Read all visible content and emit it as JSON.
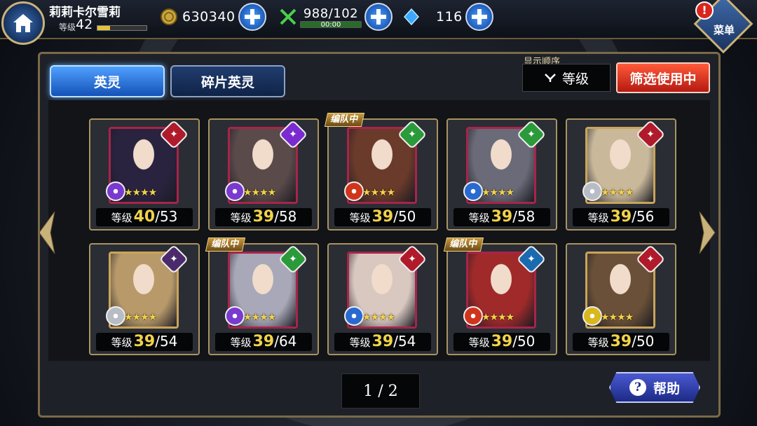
{
  "header": {
    "player_name": "莉莉卡尔雪莉",
    "level_label": "等级",
    "level_value": "42",
    "exp_fraction": 0.25,
    "gold": "630340",
    "stamina": "988/102",
    "stamina_timer": "00:00",
    "crystals": "116",
    "menu_label": "菜单",
    "alert_symbol": "!"
  },
  "tabs": [
    {
      "label": "英灵",
      "active": true
    },
    {
      "label": "碎片英灵",
      "active": false
    }
  ],
  "sort": {
    "caption": "显示顺序",
    "value": "等级"
  },
  "filter_label": "筛选使用中",
  "level_word": "等级",
  "team_tag": "编队中",
  "cards": [
    {
      "cur": "40",
      "max": "/53",
      "class_color": "#b01a2a",
      "class_icon": "sword-icon",
      "elem_color": "#7a3ad0",
      "portrait_color": "#2a2340",
      "in_team": false
    },
    {
      "cur": "39",
      "max": "/58",
      "class_color": "#7a2ad0",
      "class_icon": "witch-hat-icon",
      "elem_color": "#7a3ad0",
      "portrait_color": "#5a4a4a",
      "in_team": false
    },
    {
      "cur": "39",
      "max": "/50",
      "class_color": "#2a9a3a",
      "class_icon": "dagger-icon",
      "elem_color": "#d0351c",
      "portrait_color": "#6a3a2a",
      "in_team": true
    },
    {
      "cur": "39",
      "max": "/58",
      "class_color": "#2a9a3a",
      "class_icon": "potion-icon",
      "elem_color": "#2a6ad0",
      "portrait_color": "#6a6a78",
      "in_team": false
    },
    {
      "cur": "39",
      "max": "/56",
      "class_color": "#b01a2a",
      "class_icon": "sword-icon",
      "elem_color": "#b8bcc4",
      "portrait_color": "#c9b89a",
      "in_team": false
    },
    {
      "cur": "39",
      "max": "/54",
      "class_color": "#4a2a6a",
      "class_icon": "staff-icon",
      "elem_color": "#b8bcc4",
      "portrait_color": "#b89a6a",
      "in_team": false
    },
    {
      "cur": "39",
      "max": "/64",
      "class_color": "#2a9a3a",
      "class_icon": "wand-icon",
      "elem_color": "#7a3ad0",
      "portrait_color": "#a8a8b8",
      "in_team": true
    },
    {
      "cur": "39",
      "max": "/54",
      "class_color": "#b01a2a",
      "class_icon": "bow-icon",
      "elem_color": "#2a6ad0",
      "portrait_color": "#d8c8c0",
      "in_team": false
    },
    {
      "cur": "39",
      "max": "/50",
      "class_color": "#1a6ab0",
      "class_icon": "star-burst-icon",
      "elem_color": "#d0351c",
      "portrait_color": "#a02a2a",
      "in_team": true
    },
    {
      "cur": "39",
      "max": "/50",
      "class_color": "#b01a2a",
      "class_icon": "sword-icon",
      "elem_color": "#d8b81c",
      "portrait_color": "#6a5038",
      "in_team": false
    }
  ],
  "pager": {
    "text": "1 / 2"
  },
  "help_label": "帮助"
}
